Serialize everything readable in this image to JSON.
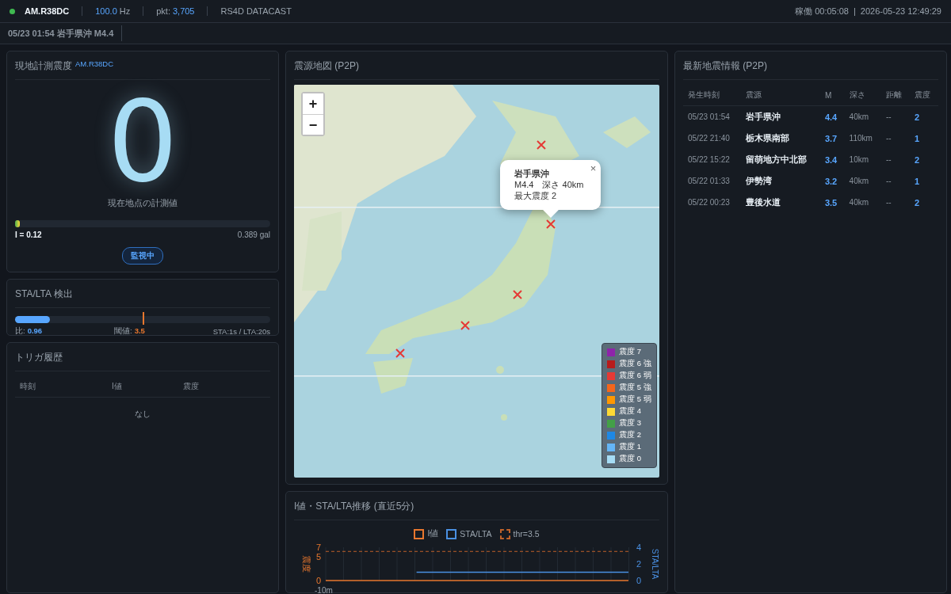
{
  "topbar": {
    "online": true,
    "station": "AM.R38DC",
    "rate_value": "100.0",
    "rate_unit": "Hz",
    "pkt_label": "pkt:",
    "pkt_value": "3,705",
    "source": "RS4D DATACAST",
    "uptime_label": "稼働",
    "uptime": "00:05:08",
    "separator": "|",
    "clock": "2026-05-23 12:49:29"
  },
  "alert_bar": {
    "text": "05/23 01:54 岩手県沖 M4.4"
  },
  "intensity_panel": {
    "title": "現地計測震度",
    "station": "AM.R38DC",
    "value": "0",
    "caption": "現在地点の計測値",
    "meter": {
      "level": 0.02
    },
    "i_value": "I = 0.12",
    "gal": "0.389 gal",
    "status": "監視中"
  },
  "sta_lta_panel": {
    "title": "STA/LTA 検出",
    "bar": {
      "level": 0.137
    },
    "threshold_marker": {
      "level": 0.5
    },
    "ratio_label": "比:",
    "ratio": "0.96",
    "threshold_label": "閾値:",
    "threshold": "3.5",
    "windows": "STA:1s / LTA:20s"
  },
  "trigger_panel": {
    "title": "トリガ履歴",
    "columns": [
      "時刻",
      "I値",
      "震度"
    ],
    "empty": "なし"
  },
  "map_panel": {
    "title": "震源地図 (P2P)",
    "zoom_in": "+",
    "zoom_out": "−",
    "popup": {
      "title": "岩手県沖",
      "line_1": "M4.4　深さ 40km",
      "line_2": "最大震度 2",
      "close": "×"
    },
    "legend": [
      {
        "label": "震度 7",
        "color": "#8e24aa"
      },
      {
        "label": "震度 6 強",
        "color": "#b71c1c"
      },
      {
        "label": "震度 6 弱",
        "color": "#e53935"
      },
      {
        "label": "震度 5 強",
        "color": "#f4661b"
      },
      {
        "label": "震度 5 弱",
        "color": "#ff9800"
      },
      {
        "label": "震度 4",
        "color": "#fdd835"
      },
      {
        "label": "震度 3",
        "color": "#43a047"
      },
      {
        "label": "震度 2",
        "color": "#1e88e5"
      },
      {
        "label": "震度 1",
        "color": "#64b5f6"
      },
      {
        "label": "震度 0",
        "color": "#a6dcf5"
      }
    ]
  },
  "chart_panel": {
    "title": "I値・STA/LTA推移 (直近5分)",
    "x_start_label": "-10m",
    "chart_data": {
      "type": "line",
      "legend": "top",
      "ylabel": "震度",
      "y2label": "STA/LTA",
      "ylim": [
        0,
        7
      ],
      "yticks": [
        0,
        5,
        7
      ],
      "y2lim": [
        0,
        4
      ],
      "y2ticks": [
        0,
        2,
        4
      ],
      "series": [
        {
          "name": "I値",
          "color": "#e8772e",
          "values": [
            0,
            0,
            0,
            0,
            0,
            0,
            0,
            0,
            0,
            0,
            0
          ]
        },
        {
          "name": "STA/LTA",
          "color": "#4a90e2",
          "axis": "y2",
          "values": [
            null,
            null,
            null,
            1.0,
            1.0,
            1.0,
            1.0,
            1.0,
            1.0,
            1.0,
            1.0
          ]
        }
      ],
      "ref_lines": [
        {
          "value": 3.5,
          "axis": "y2",
          "label": "thr=3.5",
          "color": "#c0622a"
        }
      ]
    }
  },
  "quake_panel": {
    "title": "最新地震情報 (P2P)",
    "columns": [
      "発生時刻",
      "震源",
      "M",
      "深さ",
      "距離",
      "震度"
    ],
    "rows": [
      {
        "time": "05/23 01:54",
        "place": "岩手県沖",
        "magnitude": "4.4",
        "depth": "40km",
        "distance": "--",
        "shindo": "2"
      },
      {
        "time": "05/22 21:40",
        "place": "栃木県南部",
        "magnitude": "3.7",
        "depth": "110km",
        "distance": "--",
        "shindo": "1"
      },
      {
        "time": "05/22 15:22",
        "place": "留萌地方中北部",
        "magnitude": "3.4",
        "depth": "10km",
        "distance": "--",
        "shindo": "2"
      },
      {
        "time": "05/22 01:33",
        "place": "伊勢湾",
        "magnitude": "3.2",
        "depth": "40km",
        "distance": "--",
        "shindo": "1"
      },
      {
        "time": "05/22 00:23",
        "place": "豊後水道",
        "magnitude": "3.5",
        "depth": "40km",
        "distance": "--",
        "shindo": "2"
      }
    ]
  }
}
